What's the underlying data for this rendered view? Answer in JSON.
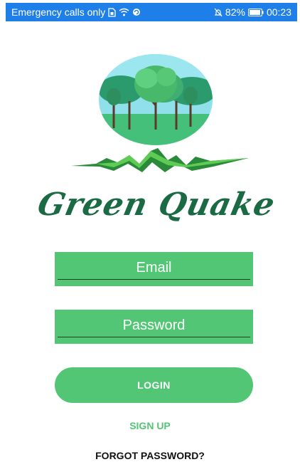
{
  "status_bar": {
    "carrier": "Emergency calls only",
    "battery": "82%",
    "time": "00:23",
    "background": "#1f7fe8"
  },
  "app": {
    "title": "Green Quake",
    "accent": "#52c675",
    "title_color": "#1a6a43"
  },
  "form": {
    "email_placeholder": "Email",
    "password_placeholder": "Password",
    "login_label": "LOGIN",
    "signup_label": "SIGN UP",
    "forgot_label": "FORGOT PASSWORD?"
  }
}
